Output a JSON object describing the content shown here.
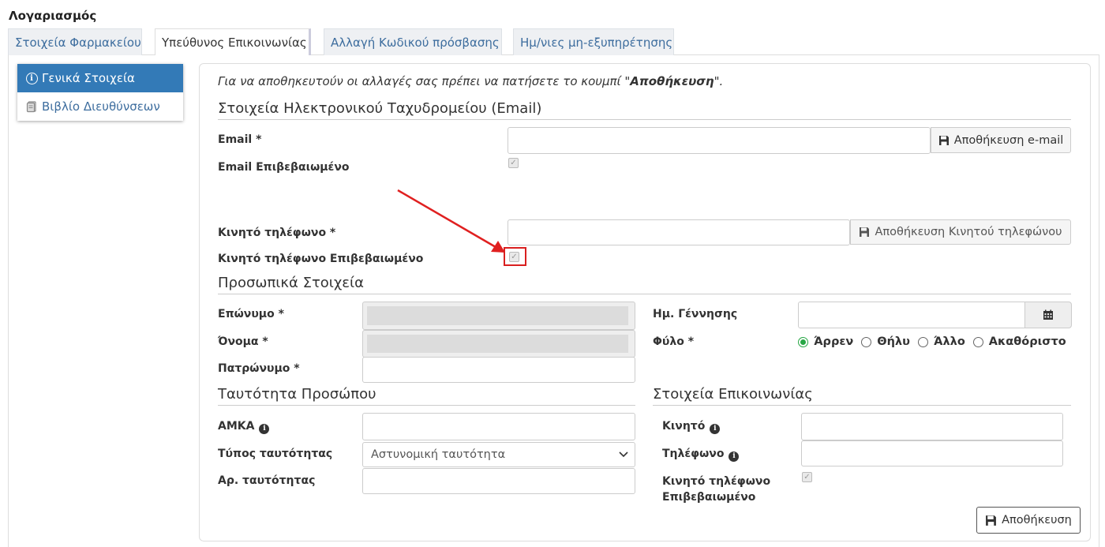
{
  "page": {
    "title": "Λογαριασμός"
  },
  "tabs": [
    {
      "label": "Στοιχεία Φαρμακείου"
    },
    {
      "label": "Υπεύθυνος Επικοινωνίας"
    },
    {
      "label": "Αλλαγή Κωδικού πρόσβασης"
    },
    {
      "label": "Ημ/νιες μη-εξυπηρέτησης"
    }
  ],
  "sidebar": {
    "items": [
      {
        "label": "Γενικά Στοιχεία",
        "icon": "info-circle-icon",
        "active": true
      },
      {
        "label": "Βιβλίο Διευθύνσεων",
        "icon": "address-book-icon",
        "active": false
      }
    ]
  },
  "notice": {
    "before": "Για να αποθηκευτούν οι αλλαγές σας πρέπει να πατήσετε το κουμπί \"",
    "bold": "Αποθήκευση",
    "after": "\"."
  },
  "email_section": {
    "heading": "Στοιχεία Ηλεκτρονικού Ταχυδρομείου (Email)",
    "email_label": "Email *",
    "email_value": "",
    "save_email_label": "Αποθήκευση e-mail",
    "email_verified_label": "Email Επιβεβαιωμένο",
    "mobile_label": "Κινητό τηλέφωνο *",
    "mobile_value": "",
    "save_mobile_label": "Αποθήκευση Κινητού τηλεφώνου",
    "mobile_verified_label": "Κινητό τηλέφωνο Επιβεβαιωμένο"
  },
  "personal_section": {
    "heading": "Προσωπικά Στοιχεία",
    "surname_label": "Επώνυμο *",
    "name_label": "Όνομα *",
    "father_label": "Πατρώνυμο *",
    "father_value": "",
    "birth_label": "Ημ. Γέννησης",
    "birth_value": "",
    "gender_label": "Φύλο *",
    "gender_options": [
      "Άρρεν",
      "Θήλυ",
      "Άλλο",
      "Ακαθόριστο"
    ],
    "gender_selected": "Άρρεν"
  },
  "identity_section": {
    "heading": "Ταυτότητα Προσώπου",
    "amka_label": "ΑΜΚΑ",
    "amka_value": "",
    "id_type_label": "Τύπος ταυτότητας",
    "id_type_value": "Αστυνομική ταυτότητα",
    "id_number_label": "Αρ. ταυτότητας",
    "id_number_value": ""
  },
  "contact_section": {
    "heading": "Στοιχεία Επικοινωνίας",
    "mobile_label": "Κινητό",
    "mobile_value": "",
    "phone_label": "Τηλέφωνο",
    "phone_value": "",
    "mobile_verified_label_1": "Κινητό τηλέφωνο",
    "mobile_verified_label_2": "Επιβεβαιωμένο"
  },
  "save_button_label": "Αποθήκευση",
  "colors": {
    "accent": "#337ab7",
    "annotation": "#e02020",
    "radio_on": "#28a745"
  }
}
